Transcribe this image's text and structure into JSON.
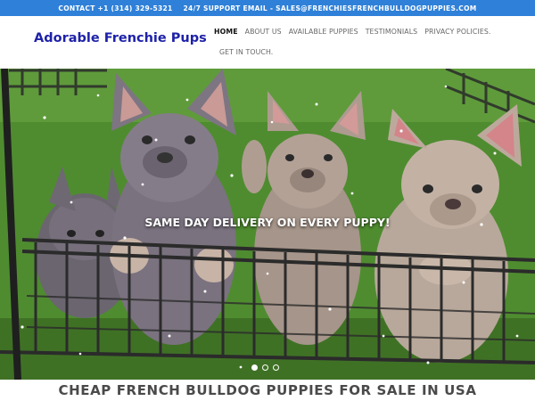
{
  "topbar": {
    "contact": "CONTACT +1 (314) 329-5321",
    "support": "24/7 SUPPORT EMAIL - SALES@FRENCHIESFRENCHBULLDOGPUPPIES.COM"
  },
  "brand": {
    "name": "Adorable Frenchie Pups"
  },
  "nav": {
    "items": [
      {
        "label": "HOME"
      },
      {
        "label": "ABOUT US"
      },
      {
        "label": "AVAILABLE PUPPIES"
      },
      {
        "label": "TESTIMONIALS"
      },
      {
        "label": "PRIVACY POLICIES."
      },
      {
        "label": "GET IN TOUCH."
      }
    ],
    "active_index": 0
  },
  "hero": {
    "caption": "SAME DAY DELIVERY ON EVERY PUPPY!",
    "slide_count": 3,
    "active_slide": 1
  },
  "main": {
    "title": "CHEAP FRENCH BULLDOG PUPPIES FOR SALE IN USA"
  },
  "colors": {
    "topbar": "#2f80d8",
    "brand": "#1e22a8",
    "nav_text": "#666666",
    "title": "#4a4a4a"
  }
}
